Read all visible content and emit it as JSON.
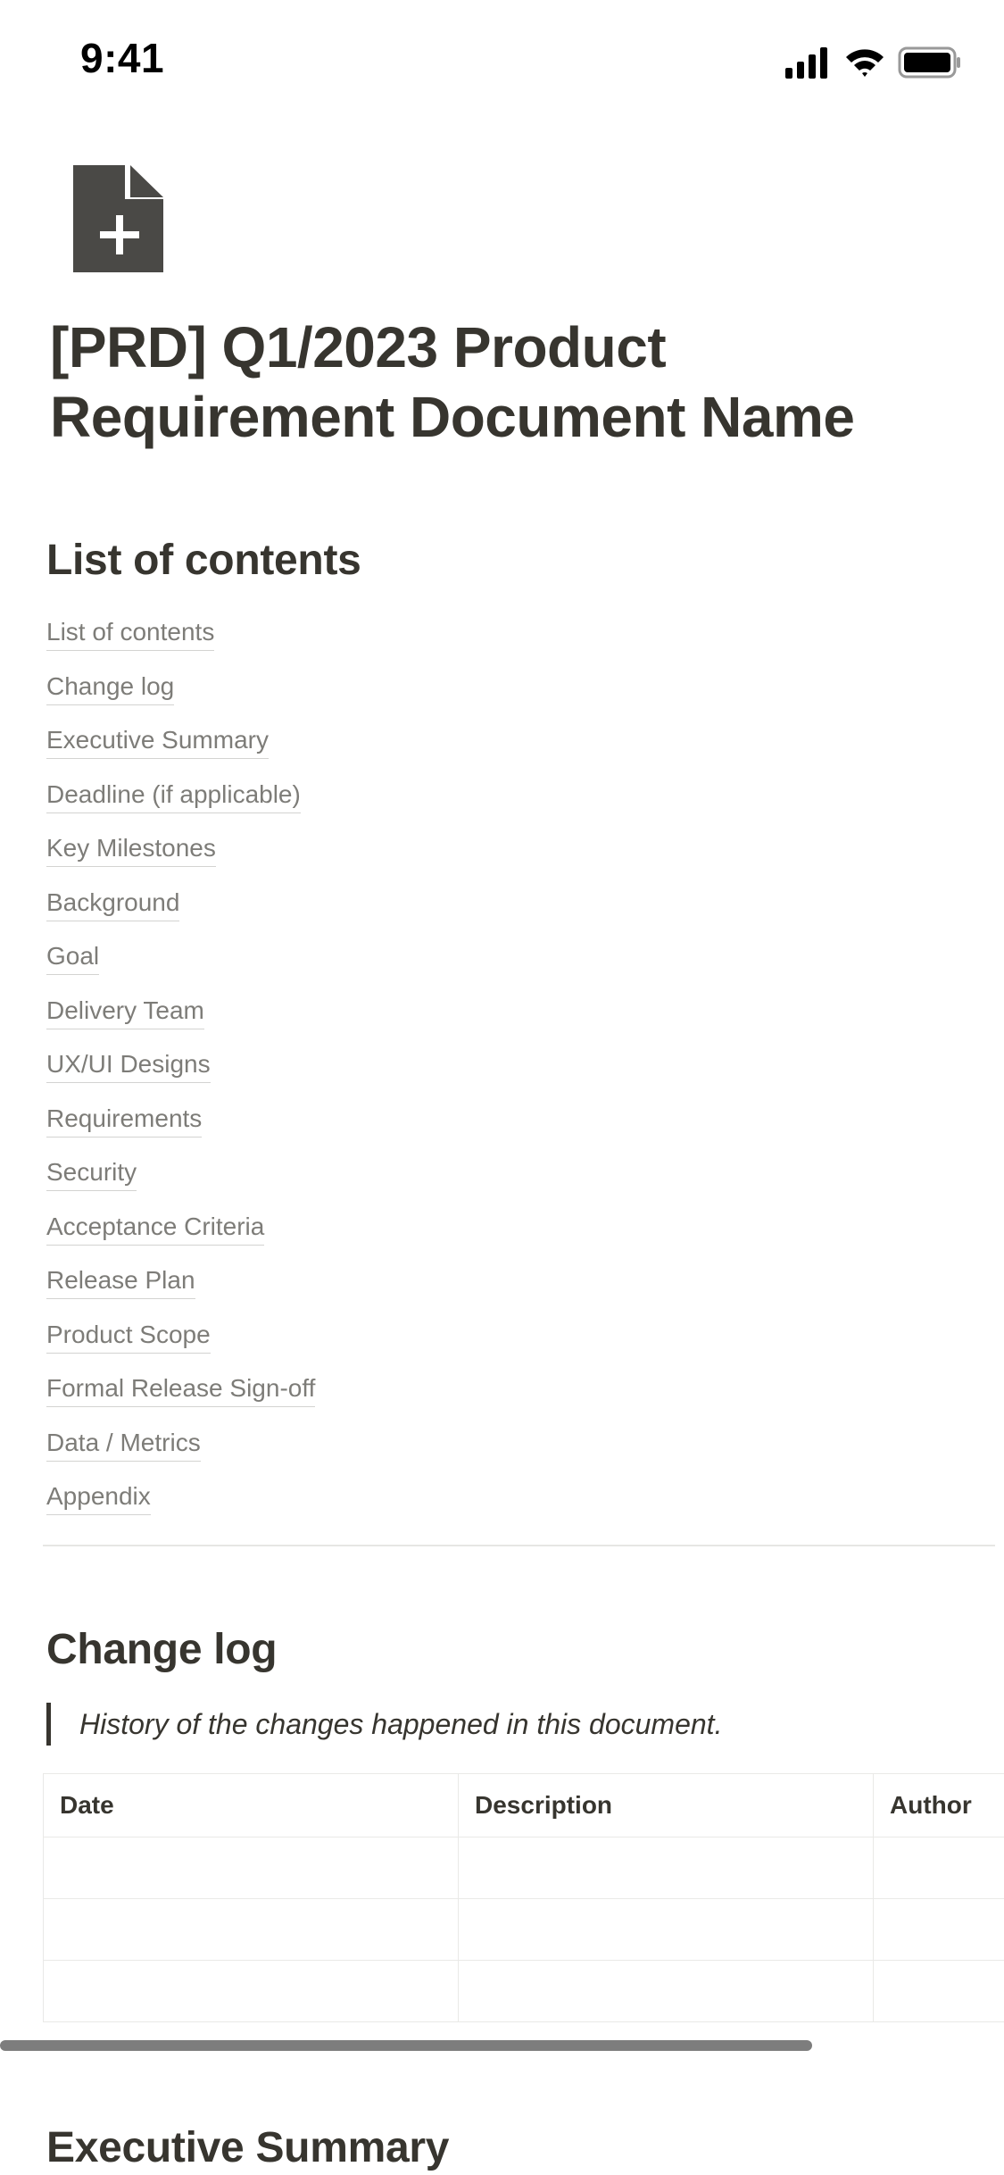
{
  "status_bar": {
    "time": "9:41"
  },
  "page": {
    "title": "[PRD] Q1/2023 Product Requirement Document Name",
    "icon": "document-plus-icon"
  },
  "toc": {
    "heading": "List of contents",
    "items": [
      "List of contents",
      "Change log",
      "Executive Summary",
      "Deadline (if applicable)",
      "Key Milestones",
      "Background",
      "Goal",
      "Delivery Team",
      "UX/UI Designs",
      "Requirements",
      "Security",
      "Acceptance Criteria",
      "Release Plan",
      "Product Scope",
      "Formal Release Sign-off",
      "Data / Metrics",
      "Appendix"
    ]
  },
  "change_log": {
    "heading": "Change log",
    "quote": "History of the changes happened in this document.",
    "columns": [
      "Date",
      "Description",
      "Author"
    ],
    "rows": [
      [
        "",
        "",
        ""
      ],
      [
        "",
        "",
        ""
      ],
      [
        "",
        "",
        ""
      ]
    ]
  },
  "executive_summary": {
    "heading": "Executive Summary"
  }
}
